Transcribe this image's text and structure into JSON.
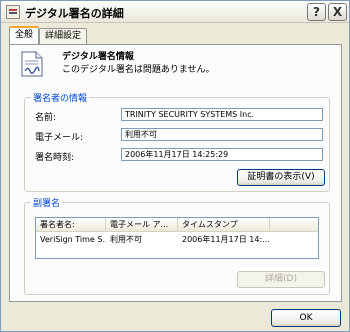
{
  "window": {
    "title": "デジタル署名の詳細",
    "help_button": "?",
    "close_button": "X"
  },
  "tabs": [
    {
      "label": "全般"
    },
    {
      "label": "詳細設定"
    }
  ],
  "info": {
    "heading": "デジタル署名情報",
    "status": "このデジタル署名は問題ありません。"
  },
  "signer_group": {
    "title": "署名者の情報",
    "name_label": "名前:",
    "name_value": "TRINITY SECURITY SYSTEMS Inc.",
    "email_label": "電子メール:",
    "email_value": "利用不可",
    "time_label": "署名時刻:",
    "time_value": "2006年11月17日 14:25:29",
    "view_cert_button": "証明書の表示(V)"
  },
  "countersign_group": {
    "title": "副署名",
    "columns": [
      "署名者名:",
      "電子メール ア...",
      "タイムスタンプ"
    ],
    "rows": [
      [
        "VeriSign Time S...",
        "利用不可",
        "2006年11月17日 14:..."
      ]
    ],
    "details_button": "詳細(D)"
  },
  "ok_button": "OK"
}
